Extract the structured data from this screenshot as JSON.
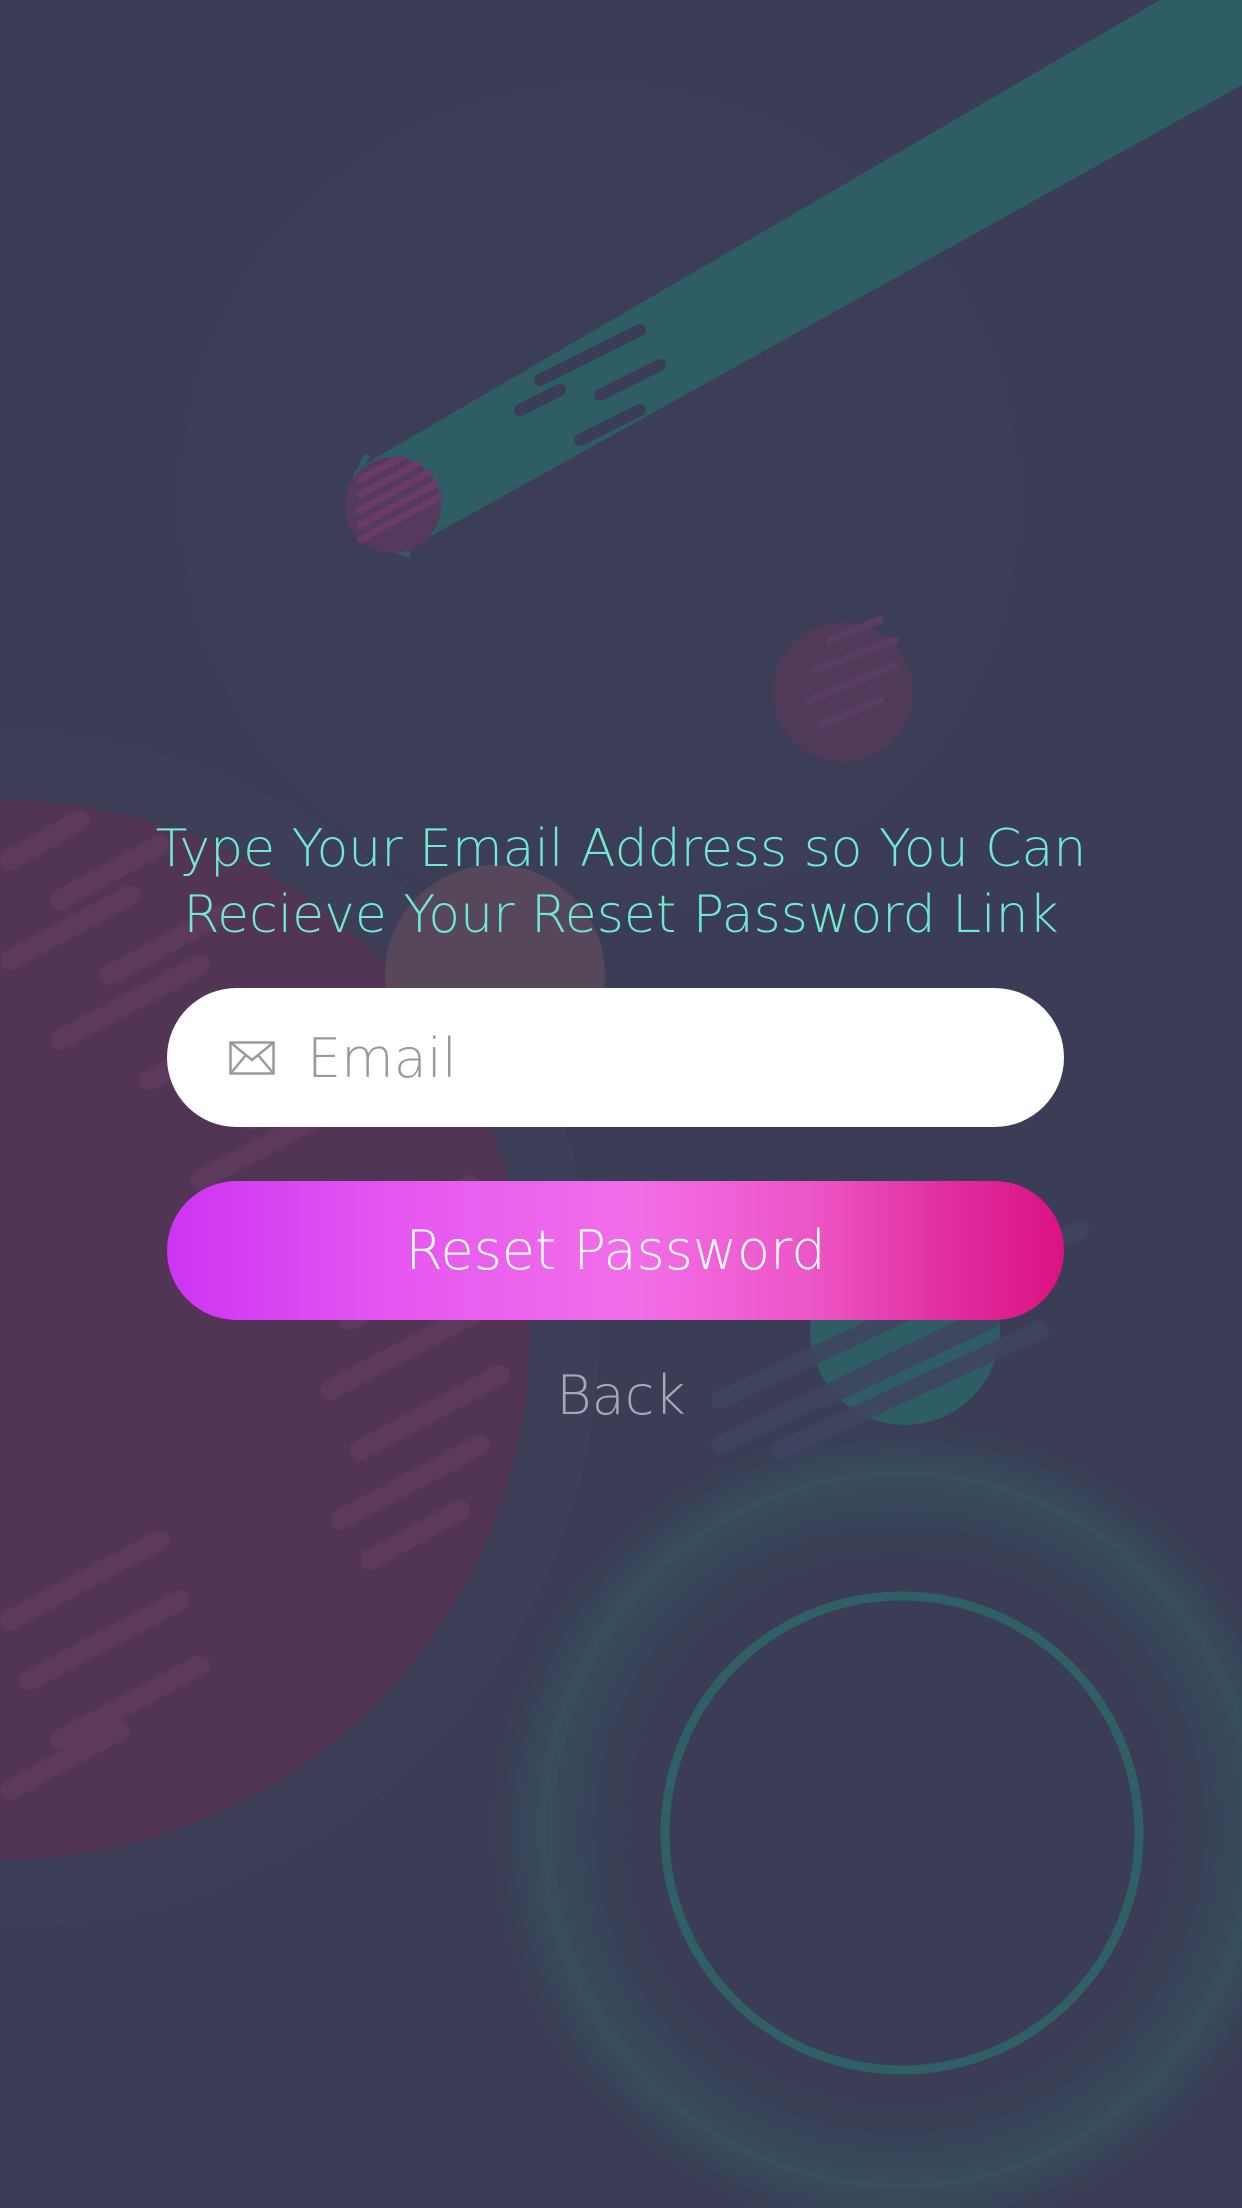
{
  "screen": {
    "instruction_line1": "Type Your Email Address so You Can",
    "instruction_line2": "Recieve Your Reset Password Link"
  },
  "email_field": {
    "placeholder": "Email",
    "value": "",
    "icon": "envelope-icon"
  },
  "reset_button": {
    "label": "Reset Password"
  },
  "back_link": {
    "label": "Back"
  },
  "colors": {
    "background": "#3a3d55",
    "heading_text": "#6fe8d6",
    "button_gradient_start": "#cc34f2",
    "button_gradient_end": "#db1282",
    "accent_teal": "#2f6e70",
    "accent_magenta": "#5a3457"
  }
}
